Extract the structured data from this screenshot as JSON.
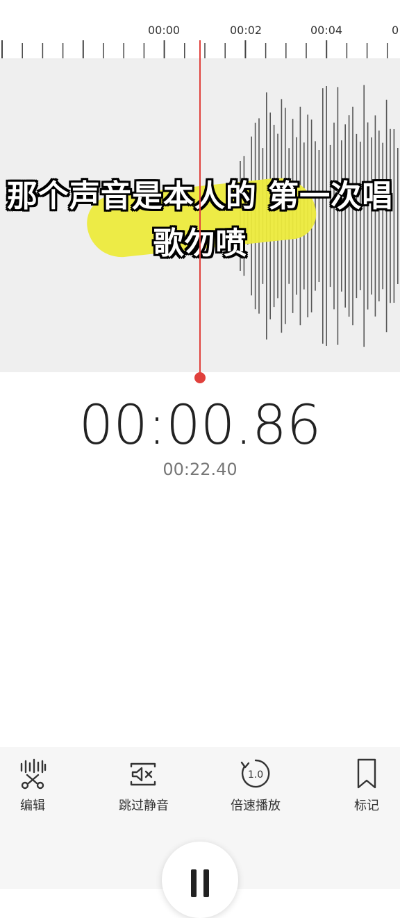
{
  "ruler": {
    "labels": [
      "00:00",
      "00:02",
      "00:04",
      "0"
    ]
  },
  "caption": {
    "line1": "那个声音是本人的 第一次唱",
    "line2": "歌勿喷"
  },
  "timer": {
    "current": "00:00.86",
    "total": "00:22.40"
  },
  "toolbar": {
    "edit_label": "编辑",
    "skip_silence_label": "跳过静音",
    "speed_label": "倍速播放",
    "speed_value": "1.0",
    "mark_label": "标记"
  },
  "colors": {
    "playhead": "#e0403c",
    "highlight": "#ecea3c",
    "wave": "#555555"
  },
  "icons": [
    "scissors-icon",
    "mute-icon",
    "speed-icon",
    "bookmark-icon",
    "pause-icon"
  ]
}
